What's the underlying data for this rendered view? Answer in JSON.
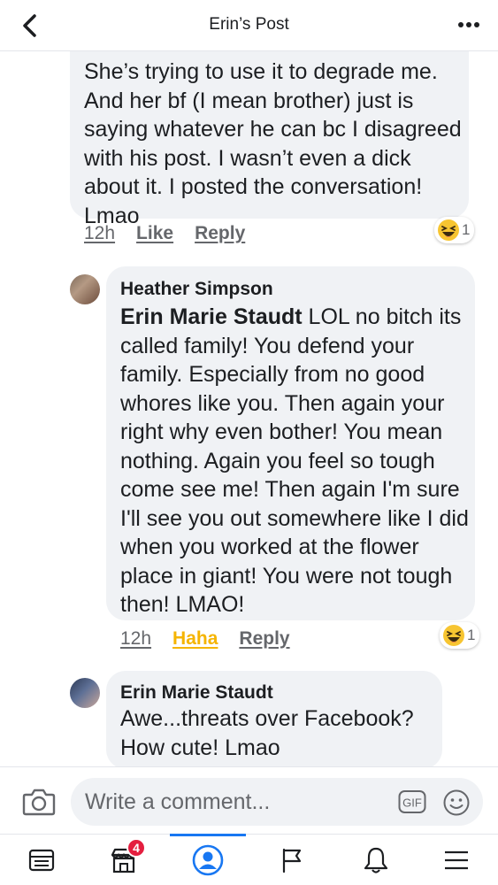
{
  "header": {
    "title": "Erin’s Post",
    "back_icon": "chevron-left-icon",
    "more_icon": "more-dots-icon"
  },
  "comments": [
    {
      "text": "She’s trying to use it to degrade me. And her bf (I mean brother) just is saying whatever he can bc I disagreed with his post. I wasn’t even a dick about it. I posted the conversation! Lmao",
      "time": "12h",
      "like_label": "Like",
      "reply_label": "Reply",
      "reaction": {
        "icon": "haha-emoji-icon",
        "count": "1"
      }
    },
    {
      "author": "Heather Simpson",
      "mention": "Erin Marie Staudt",
      "text": " LOL no bitch its called family! You defend your family. Especially from no good whores like you. Then again your right why even bother! You mean nothing.  Again you feel so tough come see me! Then again I'm sure I'll see you out somewhere like I did when you worked at the flower place in giant! You were not tough then! LMAO!",
      "time": "12h",
      "like_label": "Haha",
      "reply_label": "Reply",
      "reaction": {
        "icon": "haha-emoji-icon",
        "count": "1"
      }
    },
    {
      "author": "Erin Marie Staudt",
      "text": "Awe...threats over Facebook? How cute! Lmao"
    }
  ],
  "composer": {
    "placeholder": "Write a comment...",
    "gif_label": "GIF"
  },
  "tabbar": {
    "marketplace_badge": "4"
  },
  "colors": {
    "accent": "#1877f2",
    "haha": "#f5b400",
    "bubble": "#f0f2f5",
    "badge": "#e41e3f"
  }
}
